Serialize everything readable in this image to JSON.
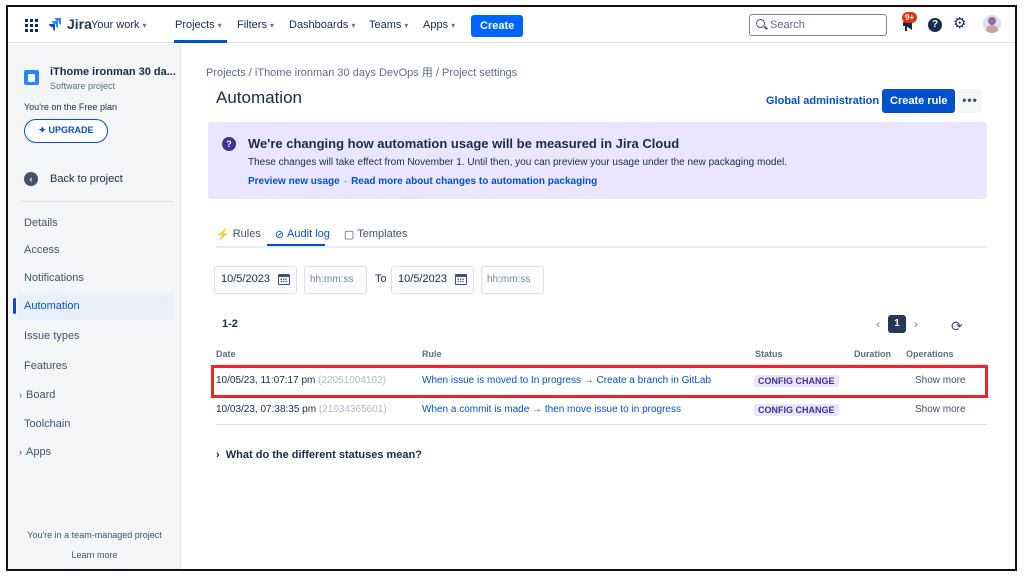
{
  "topnav": {
    "brand": "Jira",
    "items": [
      {
        "label": "Your work"
      },
      {
        "label": "Projects"
      },
      {
        "label": "Filters"
      },
      {
        "label": "Dashboards"
      },
      {
        "label": "Teams"
      },
      {
        "label": "Apps"
      }
    ],
    "create_label": "Create",
    "search_placeholder": "Search",
    "notifications_badge": "9+",
    "help_glyph": "?"
  },
  "sidebar": {
    "project_name": "iThome ironman 30 da...",
    "project_type": "Software project",
    "plan_text": "You're on the Free plan",
    "upgrade_label": "UPGRADE",
    "back_label": "Back to project",
    "items": [
      {
        "label": "Details"
      },
      {
        "label": "Access"
      },
      {
        "label": "Notifications"
      },
      {
        "label": "Automation"
      },
      {
        "label": "Issue types"
      },
      {
        "label": "Features"
      },
      {
        "label": "Board"
      },
      {
        "label": "Toolchain"
      },
      {
        "label": "Apps"
      }
    ],
    "team_managed_text": "You're in a team-managed project",
    "learn_more": "Learn more"
  },
  "main": {
    "breadcrumb": "Projects  /  iThome ironman 30 days DevOps 用  /  Project settings",
    "title": "Automation",
    "global_admin": "Global administration",
    "create_rule": "Create rule",
    "more_label": "•••",
    "banner": {
      "title": "We're changing how automation usage will be measured in Jira Cloud",
      "body": "These changes will take effect from November 1. Until then, you can preview your usage under the new packaging model.",
      "link1": "Preview new usage",
      "separator": "·",
      "link2": "Read more about changes to automation packaging"
    },
    "tabs": [
      {
        "label": "Rules",
        "glyph": "⚡"
      },
      {
        "label": "Audit log",
        "glyph": "⊘"
      },
      {
        "label": "Templates",
        "glyph": "▢"
      }
    ],
    "filters": {
      "from_date": "10/5/2023",
      "from_time_placeholder": "hh:mm:ss",
      "to_label": "To",
      "to_date": "10/5/2023",
      "to_time_placeholder": "hh:mm:ss"
    },
    "count": "1-2",
    "pagination": {
      "prev": "‹",
      "current": "1",
      "next": "›"
    },
    "table": {
      "headers": {
        "date": "Date",
        "rule": "Rule",
        "status": "Status",
        "duration": "Duration",
        "operations": "Operations"
      },
      "rows": [
        {
          "date": "10/05/23, 11:07:17 pm",
          "exec_id": "(22051004102)",
          "rule": "When issue is moved to In progress → Create a branch in GitLab",
          "status": "CONFIG CHANGE",
          "duration": "",
          "operation": "Show more"
        },
        {
          "date": "10/03/23, 07:38:35 pm",
          "exec_id": "(21934365601)",
          "rule": "When a commit is made → then move issue to in progress",
          "status": "CONFIG CHANGE",
          "duration": "",
          "operation": "Show more"
        }
      ]
    },
    "statuses_question": "What do the different statuses mean?"
  },
  "colors": {
    "primary": "#0052cc",
    "banner_bg": "#eae6ff",
    "lozenge_text": "#403294",
    "highlight": "#e8262b"
  }
}
